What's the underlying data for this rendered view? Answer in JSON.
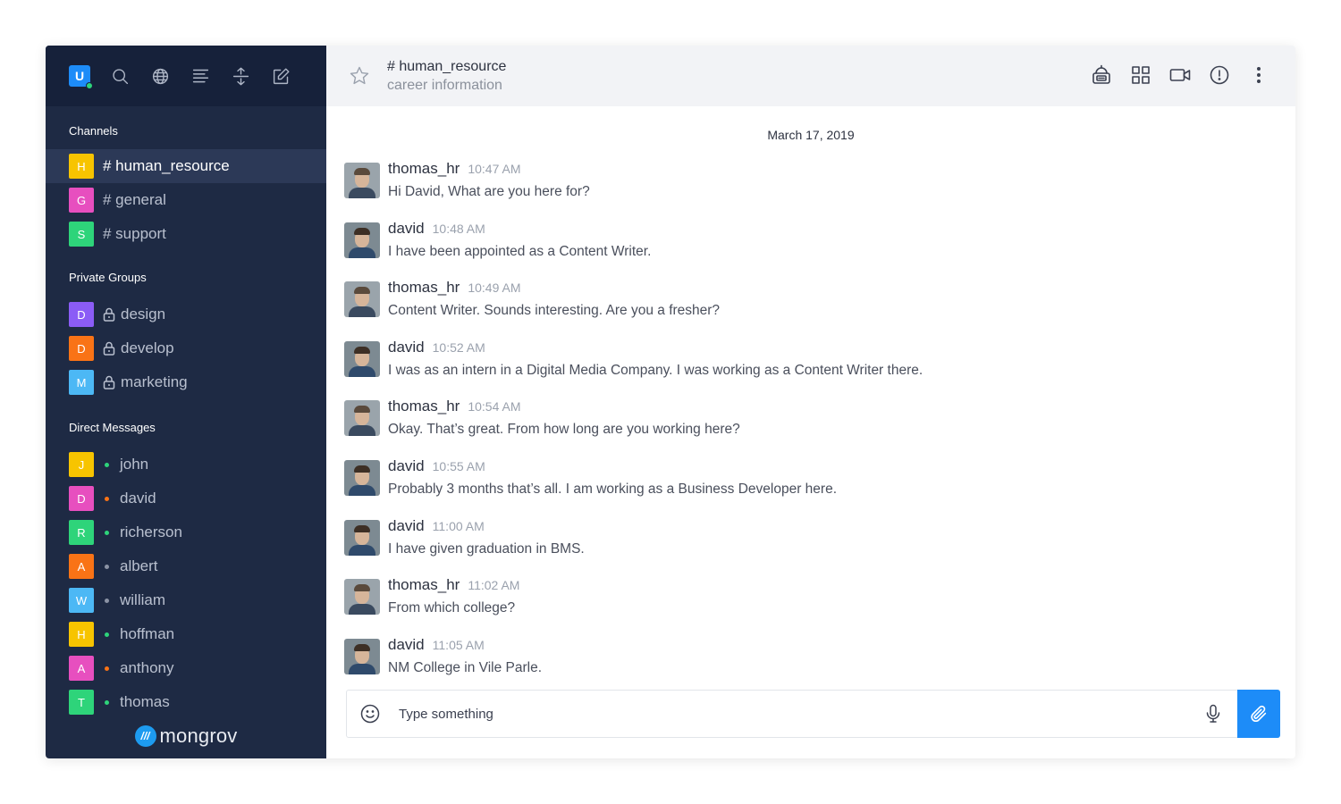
{
  "sidebar": {
    "logo_letter": "U",
    "channels_title": "Channels",
    "channels": [
      {
        "letter": "H",
        "color": "#f7c400",
        "label": "# human_resource"
      },
      {
        "letter": "G",
        "color": "#e74fbf",
        "label": "# general"
      },
      {
        "letter": "S",
        "color": "#2ed47a",
        "label": "# support"
      }
    ],
    "private_title": "Private Groups",
    "private_groups": [
      {
        "letter": "D",
        "color": "#8b5cf6",
        "label": "design"
      },
      {
        "letter": "D",
        "color": "#f97316",
        "label": "develop"
      },
      {
        "letter": "M",
        "color": "#4cb8f5",
        "label": "marketing"
      }
    ],
    "dm_title": "Direct Messages",
    "direct_messages": [
      {
        "letter": "J",
        "color": "#f7c400",
        "label": "john",
        "status": "#2ed47a"
      },
      {
        "letter": "D",
        "color": "#e74fbf",
        "label": "david",
        "status": "#f97316"
      },
      {
        "letter": "R",
        "color": "#2ed47a",
        "label": "richerson",
        "status": "#2ed47a"
      },
      {
        "letter": "A",
        "color": "#f97316",
        "label": "albert",
        "status": "#8b93a5"
      },
      {
        "letter": "W",
        "color": "#4cb8f5",
        "label": "william",
        "status": "#8b93a5"
      },
      {
        "letter": "H",
        "color": "#f7c400",
        "label": "hoffman",
        "status": "#2ed47a"
      },
      {
        "letter": "A",
        "color": "#e74fbf",
        "label": "anthony",
        "status": "#f97316"
      },
      {
        "letter": "T",
        "color": "#2ed47a",
        "label": "thomas",
        "status": "#2ed47a"
      }
    ],
    "brand": "mongrov"
  },
  "header": {
    "title": "# human_resource",
    "subtitle": "career information"
  },
  "date": "March 17, 2019",
  "messages": [
    {
      "name": "thomas_hr",
      "time": "10:47 AM",
      "text": "Hi David, What are you here for?"
    },
    {
      "name": "david",
      "time": "10:48 AM",
      "text": "I have been appointed as a Content Writer."
    },
    {
      "name": "thomas_hr",
      "time": "10:49 AM",
      "text": "Content Writer. Sounds interesting. Are you a fresher?"
    },
    {
      "name": "david",
      "time": "10:52 AM",
      "text": "I was as an intern in a Digital Media Company. I was working as a Content Writer there."
    },
    {
      "name": "thomas_hr",
      "time": "10:54 AM",
      "text": "Okay. That’s great. From how long are you working here?"
    },
    {
      "name": "david",
      "time": "10:55 AM",
      "text": "Probably 3 months that’s all. I am working as a Business Developer here."
    },
    {
      "name": "david",
      "time": "11:00 AM",
      "text": "I have given graduation in BMS."
    },
    {
      "name": "thomas_hr",
      "time": "11:02 AM",
      "text": "From which college?"
    },
    {
      "name": "david",
      "time": "11:05 AM",
      "text": "NM College in Vile Parle."
    }
  ],
  "composer": {
    "placeholder": "Type something"
  }
}
